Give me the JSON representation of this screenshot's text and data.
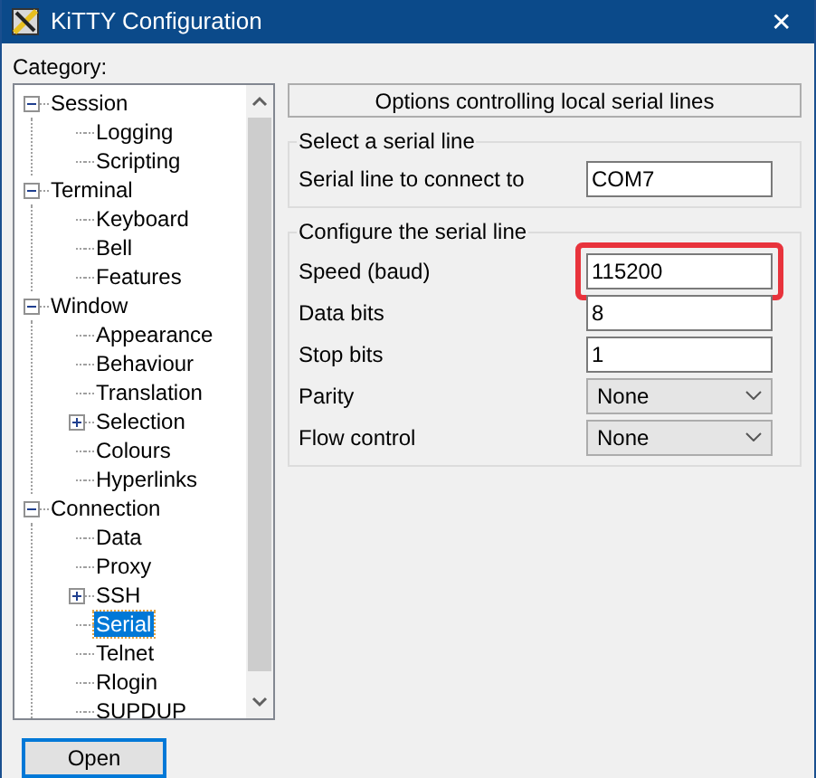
{
  "window": {
    "title": "KiTTY Configuration",
    "close": "✕"
  },
  "category_label": "Category:",
  "tree": [
    {
      "label": "Session",
      "selected": false,
      "expanded": true,
      "children": [
        {
          "label": "Logging",
          "selected": false
        },
        {
          "label": "Scripting",
          "selected": false
        }
      ]
    },
    {
      "label": "Terminal",
      "selected": false,
      "expanded": true,
      "children": [
        {
          "label": "Keyboard",
          "selected": false
        },
        {
          "label": "Bell",
          "selected": false
        },
        {
          "label": "Features",
          "selected": false
        }
      ]
    },
    {
      "label": "Window",
      "selected": false,
      "expanded": true,
      "children": [
        {
          "label": "Appearance",
          "selected": false
        },
        {
          "label": "Behaviour",
          "selected": false
        },
        {
          "label": "Translation",
          "selected": false
        },
        {
          "label": "Selection",
          "selected": false,
          "expanded": false
        },
        {
          "label": "Colours",
          "selected": false
        },
        {
          "label": "Hyperlinks",
          "selected": false
        }
      ]
    },
    {
      "label": "Connection",
      "selected": false,
      "expanded": true,
      "children": [
        {
          "label": "Data",
          "selected": false
        },
        {
          "label": "Proxy",
          "selected": false
        },
        {
          "label": "SSH",
          "selected": false,
          "expanded": false
        },
        {
          "label": "Serial",
          "selected": true
        },
        {
          "label": "Telnet",
          "selected": false
        },
        {
          "label": "Rlogin",
          "selected": false
        },
        {
          "label": "SUPDUP",
          "selected": false
        }
      ]
    }
  ],
  "panel_header": "Options controlling local serial lines",
  "groups": [
    {
      "title": "Select a serial line",
      "fields": [
        {
          "kind": "text",
          "label": "Serial line to connect to",
          "value": "COM7",
          "highlighted": false
        }
      ]
    },
    {
      "title": "Configure the serial line",
      "fields": [
        {
          "kind": "text",
          "label": "Speed (baud)",
          "value": "115200",
          "highlighted": true
        },
        {
          "kind": "text",
          "label": "Data bits",
          "value": "8",
          "highlighted": false
        },
        {
          "kind": "text",
          "label": "Stop bits",
          "value": "1",
          "highlighted": false
        },
        {
          "kind": "select",
          "label": "Parity",
          "value": "None",
          "highlighted": false
        },
        {
          "kind": "select",
          "label": "Flow control",
          "value": "None",
          "highlighted": false
        }
      ]
    }
  ],
  "buttons": [
    {
      "label": "Open"
    }
  ]
}
